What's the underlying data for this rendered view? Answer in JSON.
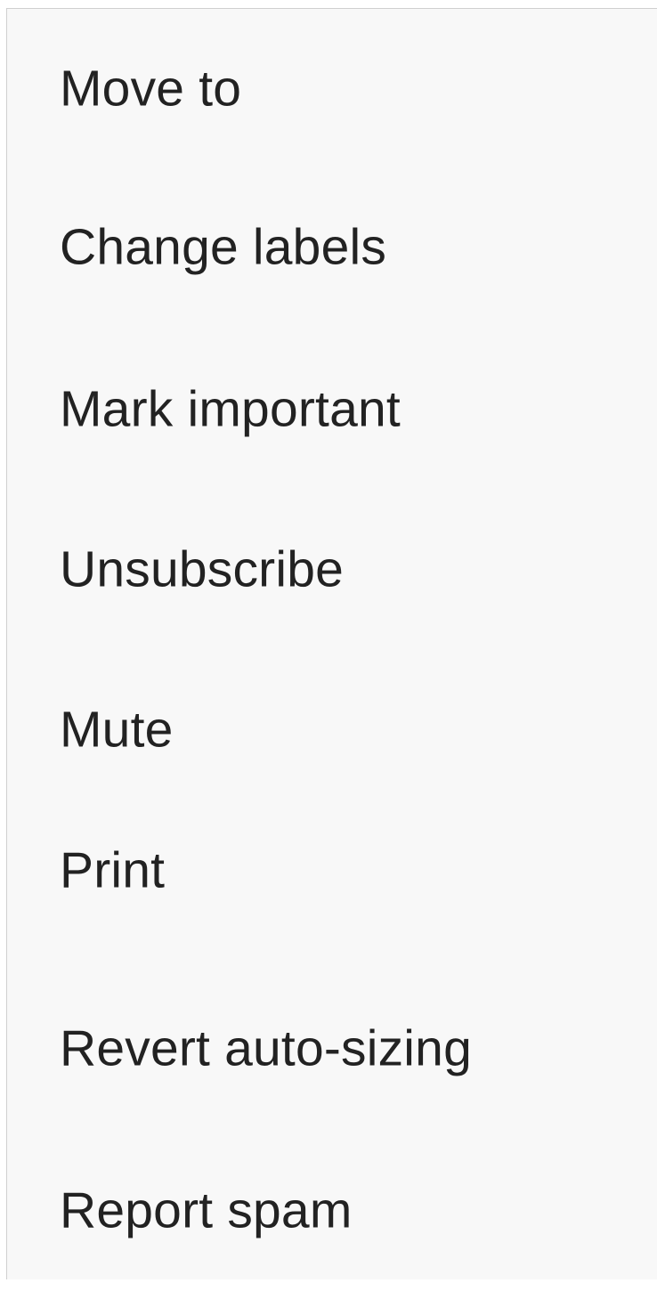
{
  "menu": {
    "items": [
      {
        "label": "Move to"
      },
      {
        "label": "Change labels"
      },
      {
        "label": "Mark important"
      },
      {
        "label": "Unsubscribe"
      },
      {
        "label": "Mute"
      },
      {
        "label": "Print"
      },
      {
        "label": "Revert auto-sizing"
      },
      {
        "label": "Report spam"
      }
    ]
  }
}
